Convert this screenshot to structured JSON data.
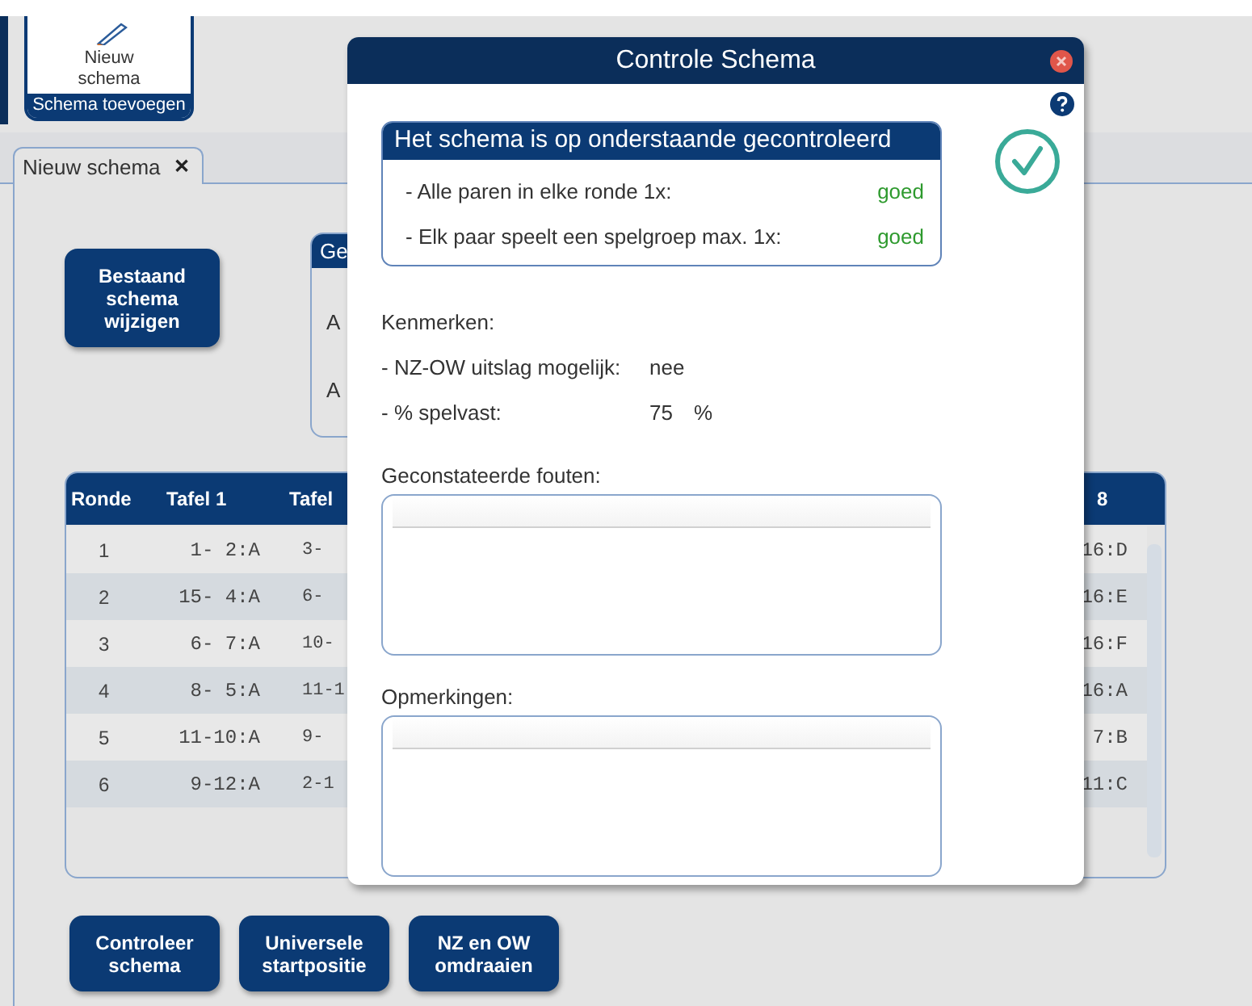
{
  "ribbon": {
    "button": "Nieuw schema",
    "group_label": "Schema toevoegen"
  },
  "tabs": [
    {
      "label": "Nieuw schema",
      "close": "✕",
      "selected": true
    }
  ],
  "edit_button": "Bestaand schema wijzigen",
  "group_box": {
    "title": "Ge",
    "lines": [
      "A",
      "A"
    ]
  },
  "table": {
    "columns": [
      "Ronde",
      "Tafel 1",
      "Tafel",
      "8"
    ],
    "rows": [
      {
        "ronde": "1",
        "tafel_1": "1- 2:A",
        "column_3": "3-",
        "column_4": "16:D"
      },
      {
        "ronde": "2",
        "tafel_1": "15- 4:A",
        "column_3": "6-",
        "column_4": "16:E"
      },
      {
        "ronde": "3",
        "tafel_1": "6- 7:A",
        "column_3": "10-",
        "column_4": "16:F"
      },
      {
        "ronde": "4",
        "tafel_1": "8- 5:A",
        "column_3": "11-1",
        "column_4": "16:A"
      },
      {
        "ronde": "5",
        "tafel_1": "11-10:A",
        "column_3": "9-",
        "column_4": "7:B"
      },
      {
        "ronde": "6",
        "tafel_1": "9-12:A",
        "column_3": "2-1",
        "column_4": "11:C"
      }
    ]
  },
  "actions": [
    "Controleer schema",
    "Universele startpositie",
    "NZ en OW omdraaien"
  ],
  "dialog": {
    "title": "Controle Schema",
    "check_title": "Het schema is op onderstaande gecontroleerd",
    "checks": [
      {
        "label": "- Alle paren in elke ronde 1x:",
        "result": "goed",
        "passed": true
      },
      {
        "label": "- Elk paar speelt een spelgroep max. 1x:",
        "result": "goed",
        "passed": true
      }
    ],
    "features_title": "Kenmerken:",
    "features": [
      {
        "label": "- NZ-OW uitslag mogelijk:",
        "value": "nee"
      },
      {
        "label": "- % spelvast:",
        "value": "75",
        "unit": "%"
      }
    ],
    "errors_label": "Geconstateerde fouten:",
    "remarks_label": "Opmerkingen:"
  }
}
